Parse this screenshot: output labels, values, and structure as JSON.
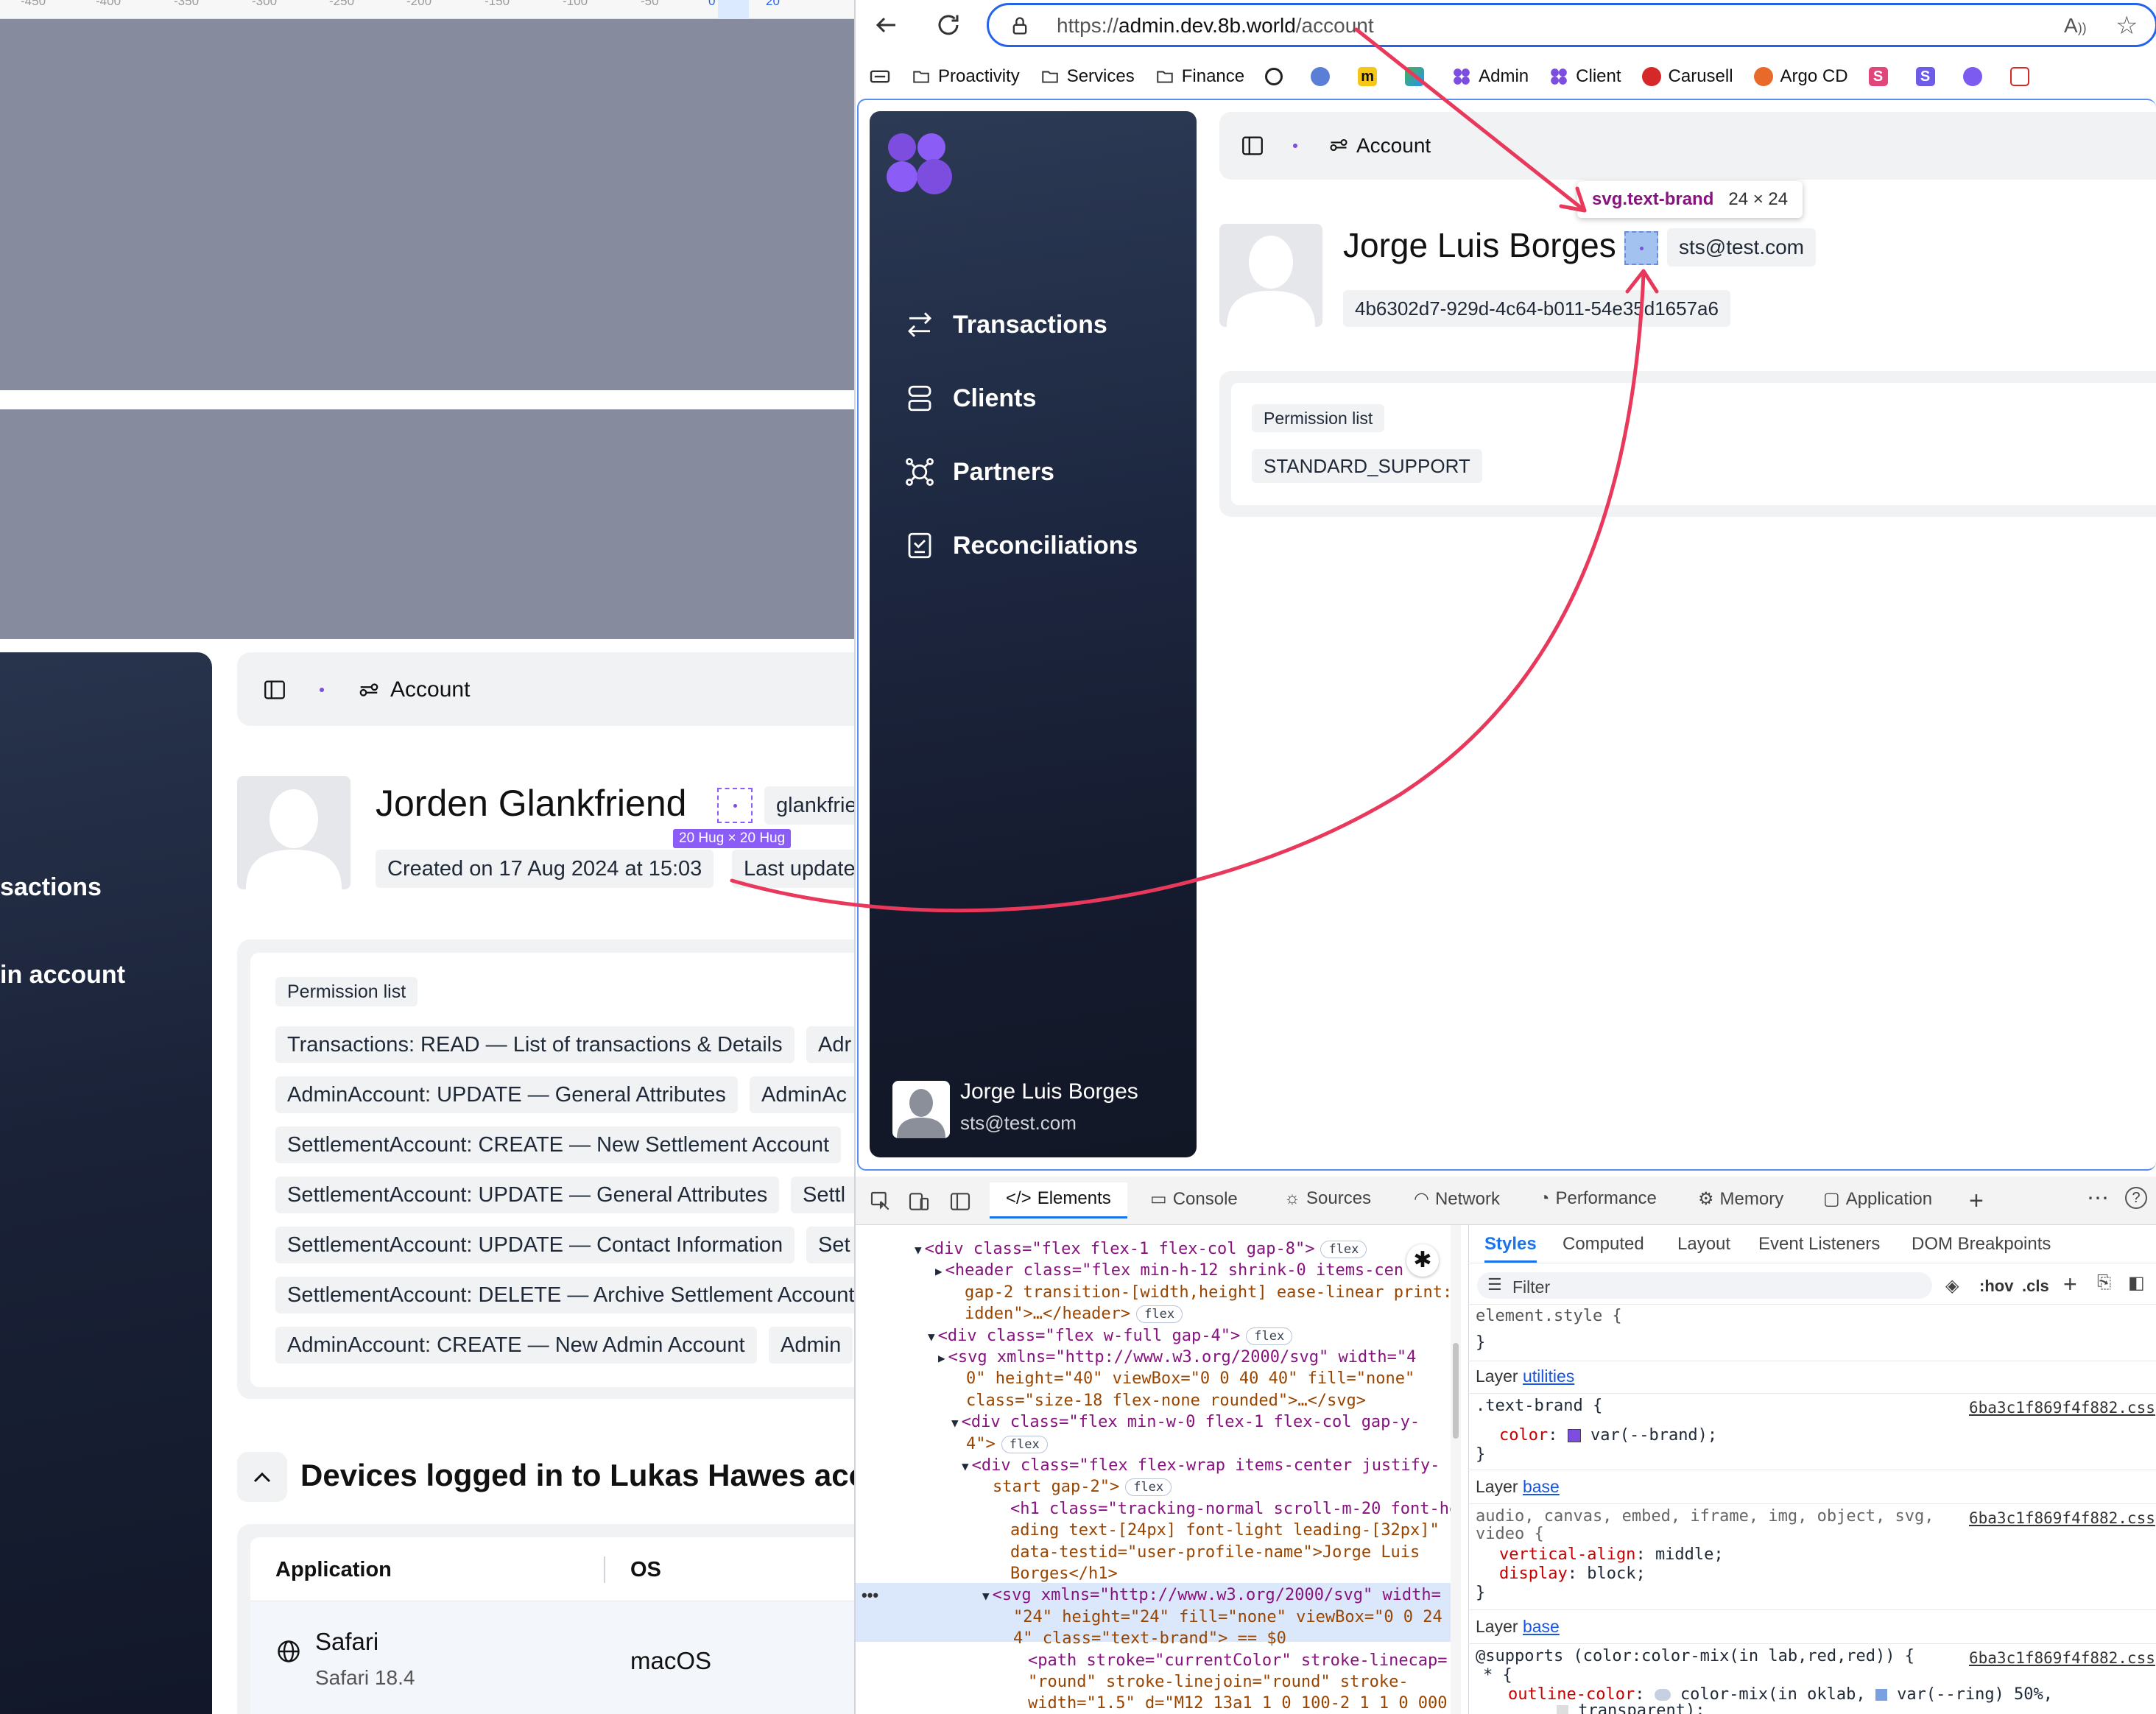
{
  "ruler": {
    "ticks": [
      "-450",
      "-400",
      "-350",
      "-300",
      "-250",
      "-200",
      "-150",
      "-100",
      "-50",
      "0",
      "20"
    ]
  },
  "left_app": {
    "nav_items": [
      "sactions",
      "in account"
    ],
    "breadcrumb": "Account",
    "user_name": "Jorden Glankfriend",
    "email_partial": "glankfrie",
    "size_badge": "20 Hug × 20 Hug",
    "created": "Created on 17 Aug 2024 at 15:03",
    "last_updated_partial": "Last update",
    "permission_heading": "Permission list",
    "permissions": [
      [
        "Transactions: READ — List of transactions & Details",
        "Adr"
      ],
      [
        "AdminAccount: UPDATE — General Attributes",
        "AdminAc"
      ],
      [
        "SettlementAccount: CREATE — New Settlement Account",
        ""
      ],
      [
        "SettlementAccount: UPDATE — General Attributes",
        "Settl"
      ],
      [
        "SettlementAccount: UPDATE — Contact Information",
        "Set"
      ],
      [
        "SettlementAccount: DELETE — Archive Settlement Account",
        ""
      ],
      [
        "AdminAccount: CREATE — New Admin Account",
        "Admin"
      ]
    ],
    "devices_title": "Devices logged in to Lukas Hawes accou",
    "devices_columns": [
      "Application",
      "OS"
    ],
    "devices_rows": [
      {
        "app": "Safari",
        "version": "Safari 18.4",
        "os": "macOS"
      }
    ]
  },
  "browser": {
    "url_prefix": "https://",
    "url_host": "admin.dev.8b.world",
    "url_path": "/account",
    "bookmarks": [
      "Proactivity",
      "Services",
      "Finance",
      "Admin",
      "Client",
      "Carusell",
      "Argo CD"
    ],
    "bookmark_colors": {
      "admin": "#7c4dde",
      "client": "#7c4dde",
      "carusell": "#d62828",
      "argo": "#e86a2a",
      "accent": "#2563eb"
    }
  },
  "right_app": {
    "nav_items": [
      "Transactions",
      "Clients",
      "Partners",
      "Reconciliations"
    ],
    "breadcrumb": "Account",
    "user_name": "Jorge Luis Borges",
    "email": "sts@test.com",
    "user_id": "4b6302d7-929d-4c64-b011-54e35d1657a6",
    "tooltip_selector": "svg.text-brand",
    "tooltip_size": "24 × 24",
    "permission_heading": "Permission list",
    "permissions": [
      "STANDARD_SUPPORT"
    ],
    "footer_name": "Jorge Luis Borges",
    "footer_email": "sts@test.com",
    "brand_color": "#7c4dde"
  },
  "devtools": {
    "tabs": [
      "Elements",
      "Console",
      "Sources",
      "Network",
      "Performance",
      "Memory",
      "Application"
    ],
    "active_tab": "Elements",
    "style_tabs": [
      "Styles",
      "Computed",
      "Layout",
      "Event Listeners",
      "DOM Breakpoints"
    ],
    "filter_placeholder": "Filter",
    "hov": ":hov",
    "cls": ".cls",
    "dom_lines": [
      {
        "text": "<div class=\"flex flex-1 flex-col gap-8\">",
        "badge": "flex"
      },
      {
        "text": "<header class=\"flex min-h-12 shrink-0 items-cen",
        "badge": ""
      },
      {
        "text": "gap-2 transition-[width,height] ease-linear print:h",
        "badge": ""
      },
      {
        "text": "idden\">…</header>",
        "badge": "flex"
      },
      {
        "text": "<div class=\"flex w-full gap-4\">",
        "badge": "flex"
      },
      {
        "text": "<svg xmlns=\"http://www.w3.org/2000/svg\" width=\"4",
        "badge": ""
      },
      {
        "text": "0\" height=\"40\" viewBox=\"0 0 40 40\" fill=\"none\"",
        "badge": ""
      },
      {
        "text": "class=\"size-18 flex-none rounded\">…</svg>",
        "badge": ""
      },
      {
        "text": "<div class=\"flex min-w-0 flex-1 flex-col gap-y-",
        "badge": ""
      },
      {
        "text": "4\">",
        "badge": "flex"
      },
      {
        "text": "<div class=\"flex flex-wrap items-center justify-",
        "badge": ""
      },
      {
        "text": "start gap-2\">",
        "badge": "flex"
      },
      {
        "text": "<h1 class=\"tracking-normal scroll-m-20 font-he",
        "badge": ""
      },
      {
        "text": "ading text-[24px] font-light leading-[32px]\"",
        "badge": ""
      },
      {
        "text": "data-testid=\"user-profile-name\">Jorge Luis",
        "badge": ""
      },
      {
        "text": "Borges</h1>",
        "badge": ""
      },
      {
        "text": "<svg xmlns=\"http://www.w3.org/2000/svg\" width=",
        "badge": ""
      },
      {
        "text": "\"24\" height=\"24\" fill=\"none\" viewBox=\"0 0 24 2",
        "badge": ""
      },
      {
        "text": "4\" class=\"text-brand\"> == $0",
        "badge": ""
      },
      {
        "text": "<path stroke=\"currentColor\" stroke-linecap=",
        "badge": ""
      },
      {
        "text": "\"round\" stroke-linejoin=\"round\" stroke-",
        "badge": ""
      },
      {
        "text": "width=\"1.5\" d=\"M12 13a1 1 0 100-2 1 1 0 000",
        "badge": ""
      }
    ],
    "styles": {
      "element_style": "element.style {",
      "close": "}",
      "layer1_label": "Layer",
      "layer1_link": "utilities",
      "rule1_selector": ".text-brand {",
      "rule1_prop": "color",
      "rule1_value": "var(--brand);",
      "source": "6ba3c1f869f4f882.css",
      "layer2_link": "base",
      "rule2_selector_1": "audio, canvas, embed, iframe, img, object, svg,",
      "rule2_selector_2": "video {",
      "rule2_prop1": "vertical-align",
      "rule2_val1": "middle;",
      "rule2_prop2": "display",
      "rule2_val2": "block;",
      "layer3_link": "base",
      "rule3_1": "@supports (color:color-mix(in lab,red,red)) {",
      "rule3_2": "* {",
      "rule3_prop": "outline-color",
      "rule3_val": "color-mix(in oklab,",
      "rule3_val2": "var(--ring) 50%,",
      "rule3_val3": "transparent);"
    }
  }
}
